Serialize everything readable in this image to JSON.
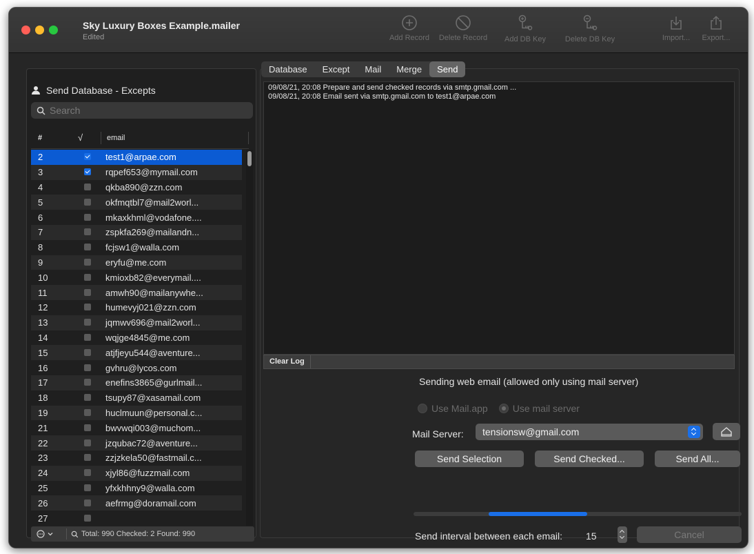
{
  "window": {
    "title": "Sky Luxury Boxes Example.mailer",
    "subtitle": "Edited"
  },
  "toolbar": {
    "add_record": "Add Record",
    "delete_record": "Delete Record",
    "add_db_key": "Add DB Key",
    "delete_db_key": "Delete DB Key",
    "import": "Import...",
    "export": "Export..."
  },
  "sidebar": {
    "title": "Send Database - Excepts",
    "search_placeholder": "Search",
    "columns": {
      "num": "#",
      "check": "√",
      "email": "email"
    },
    "rows": [
      {
        "num": "2",
        "checked": true,
        "email": "test1@arpae.com"
      },
      {
        "num": "3",
        "checked": true,
        "email": "rqpef653@mymail.com"
      },
      {
        "num": "4",
        "checked": false,
        "email": "qkba890@zzn.com"
      },
      {
        "num": "5",
        "checked": false,
        "email": "okfmqtbl7@mail2worl..."
      },
      {
        "num": "6",
        "checked": false,
        "email": "mkaxkhml@vodafone...."
      },
      {
        "num": "7",
        "checked": false,
        "email": "zspkfa269@mailandn..."
      },
      {
        "num": "8",
        "checked": false,
        "email": "fcjsw1@walla.com"
      },
      {
        "num": "9",
        "checked": false,
        "email": "eryfu@me.com"
      },
      {
        "num": "10",
        "checked": false,
        "email": "kmioxb82@everymail...."
      },
      {
        "num": "11",
        "checked": false,
        "email": "amwh90@mailanywhe..."
      },
      {
        "num": "12",
        "checked": false,
        "email": "humevyj021@zzn.com"
      },
      {
        "num": "13",
        "checked": false,
        "email": "jqmwv696@mail2worl..."
      },
      {
        "num": "14",
        "checked": false,
        "email": "wqjge4845@me.com"
      },
      {
        "num": "15",
        "checked": false,
        "email": "atjfjeyu544@aventure..."
      },
      {
        "num": "16",
        "checked": false,
        "email": "gvhru@lycos.com"
      },
      {
        "num": "17",
        "checked": false,
        "email": "enefins3865@gurlmail..."
      },
      {
        "num": "18",
        "checked": false,
        "email": "tsupy87@xasamail.com"
      },
      {
        "num": "19",
        "checked": false,
        "email": "huclmuun@personal.c..."
      },
      {
        "num": "21",
        "checked": false,
        "email": "bwvwqi003@muchom..."
      },
      {
        "num": "22",
        "checked": false,
        "email": "jzqubac72@aventure..."
      },
      {
        "num": "23",
        "checked": false,
        "email": "zzjzkela50@fastmail.c..."
      },
      {
        "num": "24",
        "checked": false,
        "email": "xjyl86@fuzzmail.com"
      },
      {
        "num": "25",
        "checked": false,
        "email": "yfxkhhny9@walla.com"
      },
      {
        "num": "26",
        "checked": false,
        "email": "aefrmg@doramail.com"
      },
      {
        "num": "27",
        "checked": false,
        "email": ""
      }
    ],
    "selected_row": 0,
    "footer": "Total: 990  Checked: 2  Found: 990"
  },
  "tabs": [
    "Database",
    "Except",
    "Mail",
    "Merge",
    "Send"
  ],
  "active_tab": "Send",
  "log": {
    "lines": [
      "09/08/21, 20:08 Prepare and send checked records via smtp.gmail.com ...",
      "09/08/21, 20:08 Email sent via smtp.gmail.com to test1@arpae.com"
    ],
    "clear_label": "Clear Log"
  },
  "send": {
    "note": "Sending web email (allowed only using mail server)",
    "radio_mailapp": "Use Mail.app",
    "radio_server": "Use mail server",
    "mail_server_label": "Mail Server:",
    "mail_server_value": "tensionsw@gmail.com",
    "send_selection": "Send Selection",
    "send_checked": "Send Checked...",
    "send_all": "Send All...",
    "progress_start": 0.23,
    "progress_end": 0.53,
    "interval_label": "Send interval between each email:",
    "interval_value": "15",
    "cancel": "Cancel"
  },
  "colors": {
    "accent": "#1a6fe8",
    "selection": "#0b5bd3",
    "window_bg": "#262626"
  }
}
